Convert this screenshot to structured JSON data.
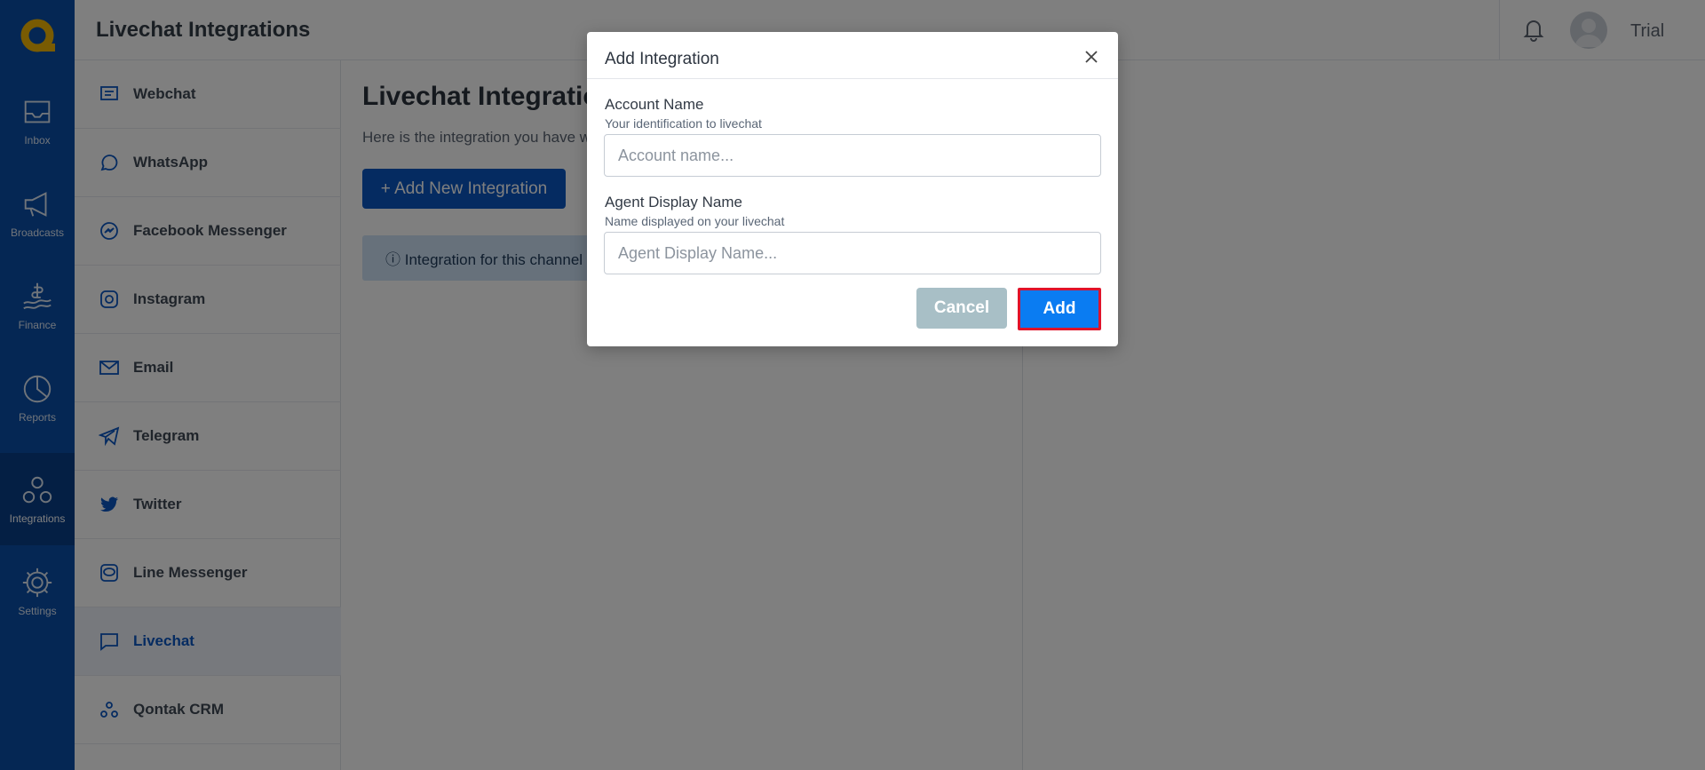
{
  "header": {
    "title": "Livechat Integrations",
    "user_name": "Trial"
  },
  "rail": {
    "items": [
      {
        "label": "Inbox",
        "icon": "inbox-icon"
      },
      {
        "label": "Broadcasts",
        "icon": "megaphone-icon"
      },
      {
        "label": "Finance",
        "icon": "finance-icon"
      },
      {
        "label": "Reports",
        "icon": "pie-chart-icon"
      },
      {
        "label": "Integrations",
        "icon": "integrations-icon",
        "active": true
      },
      {
        "label": "Settings",
        "icon": "gear-icon"
      }
    ]
  },
  "channels": {
    "items": [
      {
        "label": "Webchat",
        "icon": "webchat-icon"
      },
      {
        "label": "WhatsApp",
        "icon": "whatsapp-icon"
      },
      {
        "label": "Facebook Messenger",
        "icon": "messenger-icon"
      },
      {
        "label": "Instagram",
        "icon": "instagram-icon"
      },
      {
        "label": "Email",
        "icon": "email-icon"
      },
      {
        "label": "Telegram",
        "icon": "telegram-icon"
      },
      {
        "label": "Twitter",
        "icon": "twitter-icon"
      },
      {
        "label": "Line Messenger",
        "icon": "line-icon"
      },
      {
        "label": "Livechat",
        "icon": "livechat-icon",
        "active": true
      },
      {
        "label": "Qontak CRM",
        "icon": "crm-icon"
      }
    ]
  },
  "main": {
    "title": "Livechat Integration",
    "subtitle": "Here is the integration you have w",
    "add_new_label": "+ Add New Integration",
    "info_text": "ⓘ Integration for this channel i"
  },
  "modal": {
    "title": "Add Integration",
    "account_name_label": "Account Name",
    "account_name_help": "Your identification to livechat",
    "account_name_placeholder": "Account name...",
    "agent_name_label": "Agent Display Name",
    "agent_name_help": "Name displayed on your livechat",
    "agent_name_placeholder": "Agent Display Name...",
    "cancel_label": "Cancel",
    "add_label": "Add"
  },
  "colors": {
    "brand": "#0a4ea8",
    "accent": "#0a56c2",
    "add_button": "#0a7cf2",
    "highlight": "#e0132a",
    "logo": "#f2b705"
  }
}
